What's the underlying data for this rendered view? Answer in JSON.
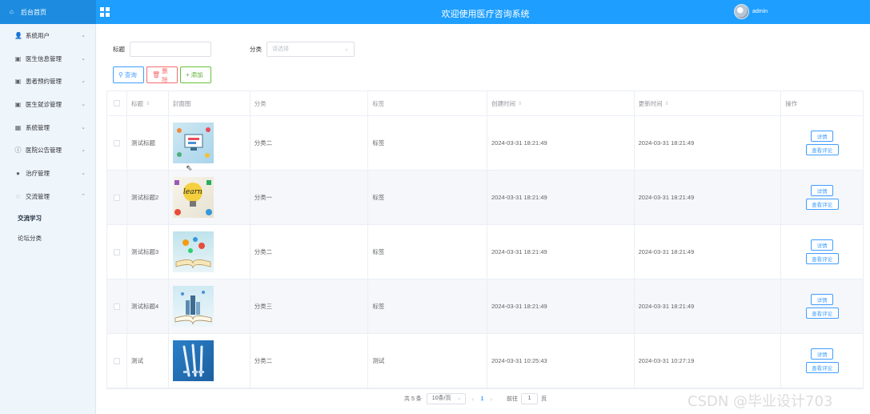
{
  "header": {
    "home_label": "后台首页",
    "title": "欢迎使用医疗咨询系统",
    "username": "admin"
  },
  "sidebar": {
    "items": [
      {
        "label": "系统用户",
        "icon": "user-icon",
        "expanded": false
      },
      {
        "label": "医生信息管理",
        "icon": "edit-icon",
        "expanded": false
      },
      {
        "label": "患者预约管理",
        "icon": "edit-icon",
        "expanded": false
      },
      {
        "label": "医生就诊管理",
        "icon": "edit-icon",
        "expanded": false
      },
      {
        "label": "系统管理",
        "icon": "picture-icon",
        "expanded": false
      },
      {
        "label": "医院公告管理",
        "icon": "info-icon",
        "expanded": false
      },
      {
        "label": "治疗管理",
        "icon": "location-icon",
        "expanded": false
      },
      {
        "label": "交流管理",
        "icon": "chat-icon",
        "expanded": true
      }
    ],
    "subitems": [
      {
        "label": "交流学习",
        "active": true
      },
      {
        "label": "论坛分类",
        "active": false
      }
    ]
  },
  "search": {
    "title_label": "标题",
    "title_value": "",
    "category_label": "分类",
    "category_placeholder": "请选择"
  },
  "toolbar": {
    "query_label": "查询",
    "delete_label": "删除",
    "add_label": "添加"
  },
  "table": {
    "columns": [
      "标题",
      "封面图",
      "分类",
      "标签",
      "创建时间",
      "更新时间",
      "操作"
    ],
    "rows": [
      {
        "title": "测试标题",
        "category": "分类二",
        "tag": "标签",
        "created": "2024-03-31 18:21:49",
        "updated": "2024-03-31 18:21:49",
        "image": "tech-illustration"
      },
      {
        "title": "测试标题2",
        "category": "分类一",
        "tag": "标签",
        "created": "2024-03-31 18:21:49",
        "updated": "2024-03-31 18:21:49",
        "image": "learn-lightbulb"
      },
      {
        "title": "测试标题3",
        "category": "分类二",
        "tag": "标签",
        "created": "2024-03-31 18:21:49",
        "updated": "2024-03-31 18:21:49",
        "image": "open-book-ideas"
      },
      {
        "title": "测试标题4",
        "category": "分类三",
        "tag": "标签",
        "created": "2024-03-31 18:21:49",
        "updated": "2024-03-31 18:21:49",
        "image": "book-city"
      },
      {
        "title": "测试",
        "category": "分类二",
        "tag": "测试",
        "created": "2024-03-31 10:25:43",
        "updated": "2024-03-31 10:27:19",
        "image": "syringes"
      }
    ],
    "detail_label": "详情",
    "review_label": "查看评论"
  },
  "pagination": {
    "total": "共 5 条",
    "page_size": "10条/页",
    "current_page": "1",
    "goto_label": "前往",
    "goto_value": "1",
    "page_suffix": "页"
  },
  "watermark": "CSDN @毕业设计703",
  "colors": {
    "header": "#1e9fff",
    "sidebar": "#eef5fb",
    "primary": "#409eff",
    "danger": "#f56c6c",
    "success": "#67c23a"
  }
}
